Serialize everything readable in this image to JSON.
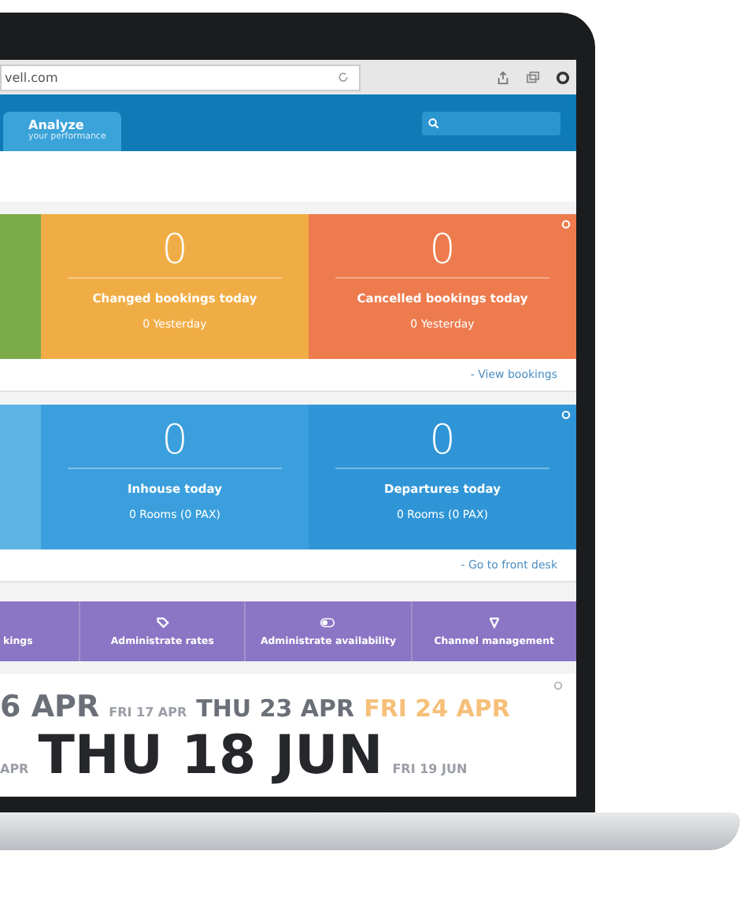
{
  "browser": {
    "url": "vell.com"
  },
  "nav": {
    "tabs": [
      {
        "label": "Analyze",
        "sublabel": "your performance",
        "selected": true
      }
    ]
  },
  "booking_cards": [
    {
      "color": "#7cac4a"
    },
    {
      "value": "0",
      "title": "Changed bookings today",
      "sub": "0 Yesterday",
      "color": "#f1ad45"
    },
    {
      "value": "0",
      "title": "Cancelled bookings today",
      "sub": "0 Yesterday",
      "color": "#ee7b4e"
    }
  ],
  "booking_link": "- View bookings",
  "desk_cards": [
    {
      "color": "#5db3e4"
    },
    {
      "value": "0",
      "title": "Inhouse today",
      "sub": "0 Rooms (0 PAX)",
      "color": "#3a9fdc"
    },
    {
      "value": "0",
      "title": "Departures today",
      "sub": "0 Rooms (0 PAX)",
      "color": "#2f95d6"
    }
  ],
  "desk_link": "- Go to front desk",
  "actions": [
    {
      "label": "kings",
      "kind": "none"
    },
    {
      "label": "Administrate rates",
      "kind": "tag"
    },
    {
      "label": "Administrate availability",
      "kind": "toggle"
    },
    {
      "label": "Channel management",
      "kind": "network"
    }
  ],
  "dates": [
    [
      {
        "text": "6 APR",
        "kind": "large",
        "highlight": false
      },
      {
        "text": "FRI 17 APR",
        "kind": "small",
        "highlight": false
      },
      {
        "text": "THU 23 APR",
        "kind": "medium",
        "highlight": false
      },
      {
        "text": "FRI 24 APR",
        "kind": "medium",
        "highlight": true
      }
    ],
    [
      {
        "text": "APR",
        "kind": "small",
        "highlight": false
      },
      {
        "text": "THU 18 JUN",
        "kind": "huge",
        "highlight": false
      },
      {
        "text": "FRI 19 JUN",
        "kind": "small",
        "highlight": false
      }
    ]
  ]
}
